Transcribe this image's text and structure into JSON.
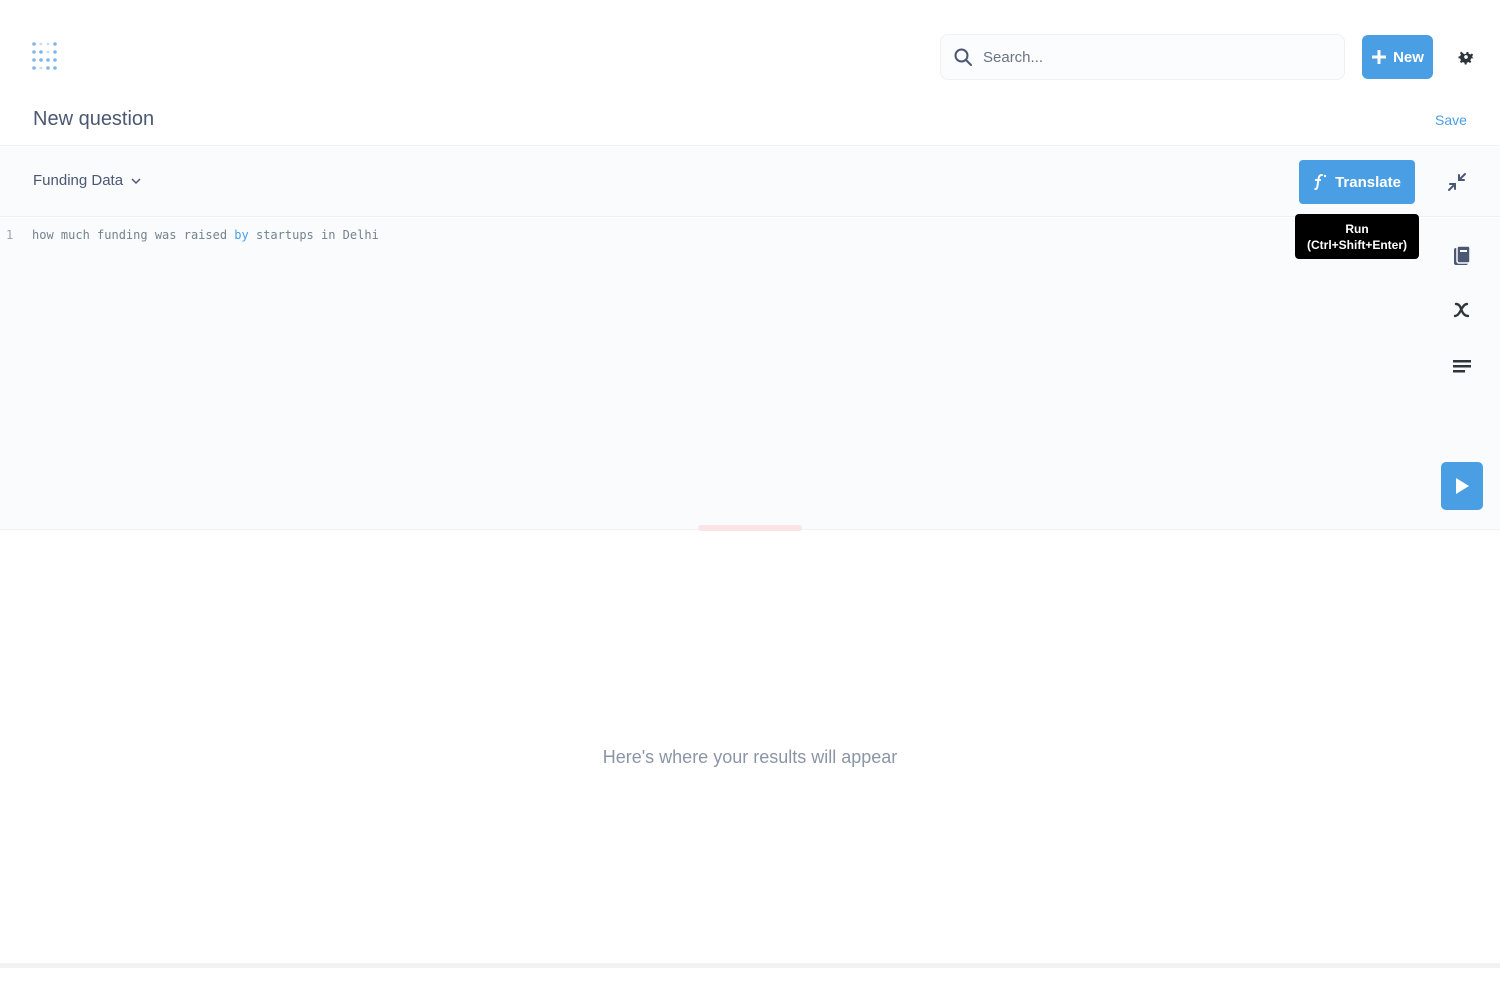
{
  "header": {
    "search_placeholder": "Search...",
    "new_button": "New"
  },
  "question": {
    "title": "New question",
    "save": "Save"
  },
  "editor": {
    "database": "Funding Data",
    "translate_button": "Translate",
    "tooltip": {
      "line1": "Run",
      "line2": "(Ctrl+Shift+Enter)"
    },
    "line_number": "1",
    "code": {
      "part1": "how much funding was raised ",
      "keyword": "by",
      "part2": " startups in Delhi"
    }
  },
  "results": {
    "placeholder": "Here's where your results will appear"
  },
  "colors": {
    "accent": "#4a9ee3",
    "text": "#4c5773",
    "editor_bg": "#f9fbfc"
  }
}
